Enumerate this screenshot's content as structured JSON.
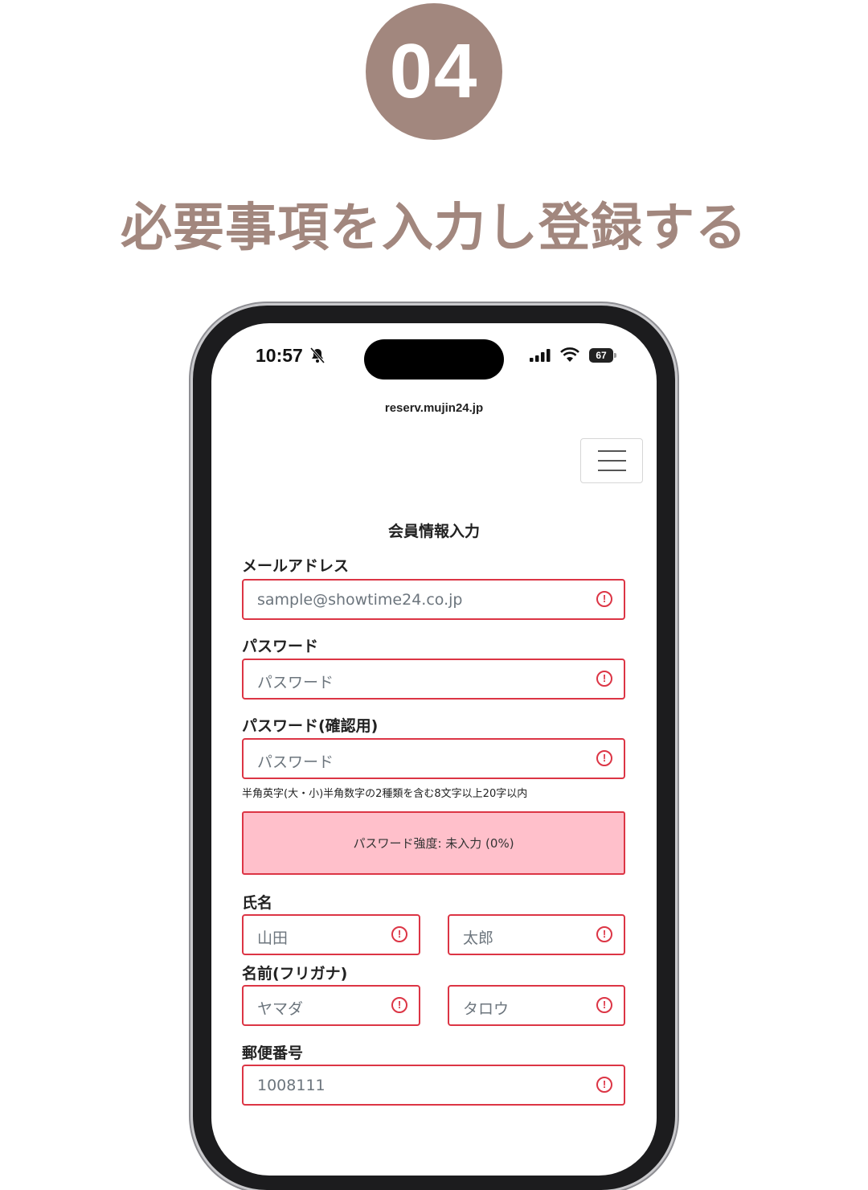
{
  "step": {
    "number": "04",
    "title": "必要事項を入力し登録する"
  },
  "status_bar": {
    "time": "10:57",
    "battery": "67"
  },
  "browser": {
    "url": "reserv.mujin24.jp"
  },
  "form": {
    "title": "会員情報入力",
    "email": {
      "label": "メールアドレス",
      "placeholder": "sample@showtime24.co.jp"
    },
    "password": {
      "label": "パスワード",
      "placeholder": "パスワード"
    },
    "password_confirm": {
      "label": "パスワード(確認用)",
      "placeholder": "パスワード"
    },
    "password_hint": "半角英字(大・小)半角数字の2種類を含む8文字以上20字以内",
    "password_strength": "パスワード強度: 未入力 (0%)",
    "name": {
      "label": "氏名",
      "last_placeholder": "山田",
      "first_placeholder": "太郎"
    },
    "kana": {
      "label": "名前(フリガナ)",
      "last_placeholder": "ヤマダ",
      "first_placeholder": "タロウ"
    },
    "postal": {
      "label": "郵便番号",
      "placeholder": "1008111"
    }
  },
  "colors": {
    "accent": "#a2877e",
    "error": "#dc3545",
    "strength_bg": "#ffc0cb"
  },
  "icons": [
    "bell-slash-icon",
    "signal-icon",
    "wifi-icon",
    "battery-icon",
    "hamburger-menu-icon",
    "alert-circle-icon"
  ]
}
